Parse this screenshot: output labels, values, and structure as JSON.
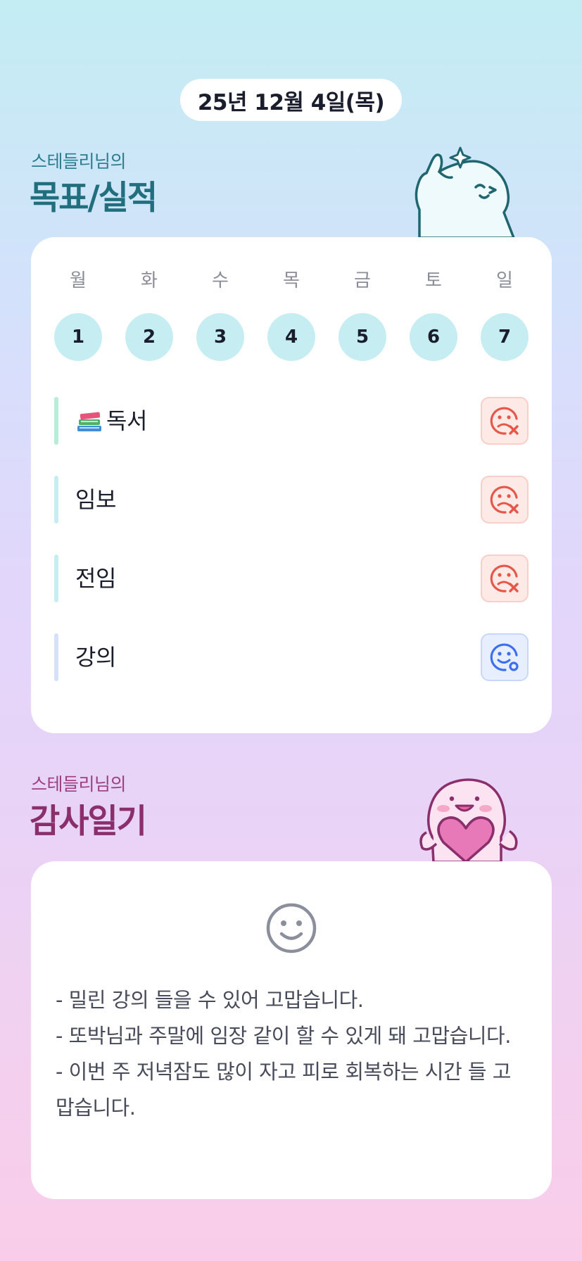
{
  "date": "25년 12월 4일(목)",
  "goals_section": {
    "subtitle": "스테들리님의",
    "title": "목표/실적"
  },
  "week": [
    {
      "day": "월",
      "num": "1"
    },
    {
      "day": "화",
      "num": "2"
    },
    {
      "day": "수",
      "num": "3"
    },
    {
      "day": "목",
      "num": "4"
    },
    {
      "day": "금",
      "num": "5"
    },
    {
      "day": "토",
      "num": "6"
    },
    {
      "day": "일",
      "num": "7"
    }
  ],
  "goals": [
    {
      "label": "독서",
      "icon": "books-emoji",
      "status": "fail",
      "bar_color": "#b7ecd6"
    },
    {
      "label": "임보",
      "status": "fail",
      "bar_color": "#c6eef2"
    },
    {
      "label": "전임",
      "status": "fail",
      "bar_color": "#c6eef2"
    },
    {
      "label": "강의",
      "status": "done",
      "bar_color": "#d4e1fb"
    }
  ],
  "gratitude_section": {
    "subtitle": "스테들리님의",
    "title": "감사일기",
    "icon": "smile-icon",
    "lines": [
      "- 밀린 강의 들을 수 있어 고맙습니다.",
      "- 또박님과 주말에 임장 같이 할 수 있게 돼 고맙습니다.",
      "- 이번 주 저녁잠도 많이 자고 피로 회복하는 시간 들 고맙습니다."
    ]
  },
  "colors": {
    "goal_title": "#216f7e",
    "gratitude_title": "#8a2e6c",
    "fail_status": "#e6574a",
    "done_status": "#3b6ef0",
    "day_circle": "#c6eef2"
  }
}
